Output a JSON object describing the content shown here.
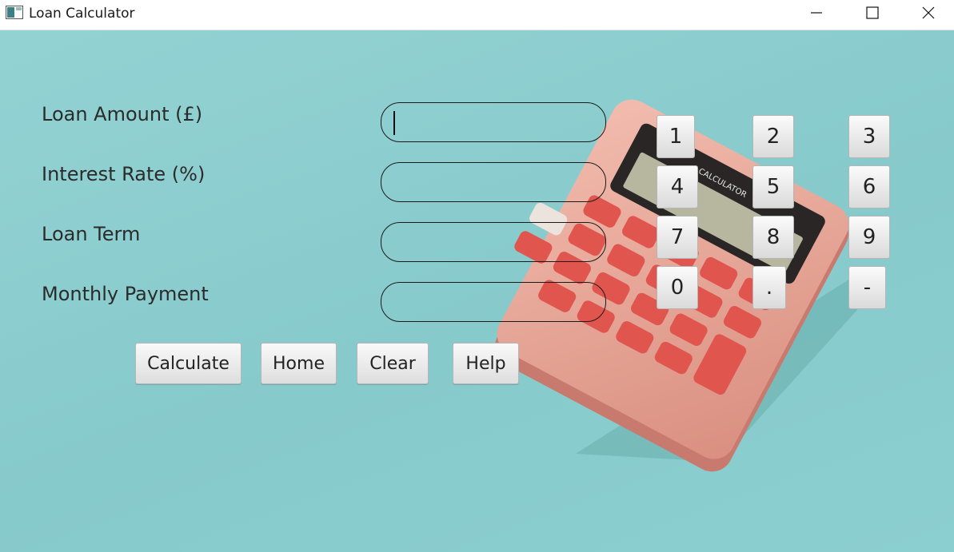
{
  "window": {
    "title": "Loan Calculator",
    "controls": [
      "minimize-icon",
      "maximize-icon",
      "close-icon"
    ]
  },
  "form": {
    "fields": [
      {
        "label": "Loan Amount (£)",
        "value": ""
      },
      {
        "label": "Interest Rate (%)",
        "value": ""
      },
      {
        "label": "Loan Term",
        "value": ""
      },
      {
        "label": "Monthly Payment",
        "value": ""
      }
    ],
    "buttons": [
      "Calculate",
      "Home",
      "Clear",
      "Help"
    ]
  },
  "keypad": {
    "keys": [
      "1",
      "2",
      "3",
      "4",
      "5",
      "6",
      "7",
      "8",
      "9",
      "0",
      ".",
      "-"
    ]
  },
  "background": {
    "description_icon": "calculator-photo",
    "screen_text": "CALCULATOR",
    "colors": {
      "backdrop": "#8ecfd0",
      "calculator_body": "#e8a89a",
      "calculator_keys": "#e0564f"
    }
  }
}
